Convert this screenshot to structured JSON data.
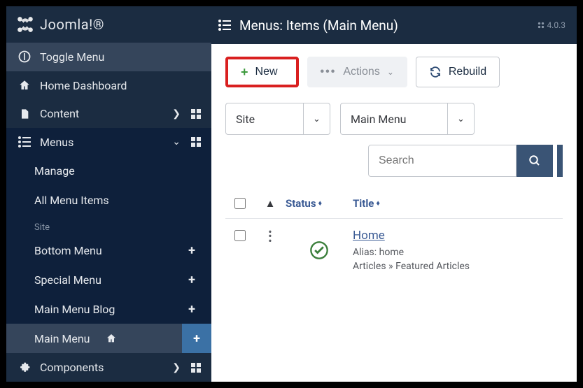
{
  "brand": {
    "name": "Joomla!®"
  },
  "version": "4.0.3",
  "sidebar": {
    "toggle": "Toggle Menu",
    "items": [
      {
        "label": "Home Dashboard",
        "icon": "home"
      },
      {
        "label": "Content",
        "icon": "file",
        "chevron": "right",
        "grid": true
      },
      {
        "label": "Menus",
        "icon": "list",
        "chevron": "down",
        "grid": true,
        "expanded": true
      },
      {
        "label": "Components",
        "icon": "puzzle",
        "chevron": "right",
        "grid": true
      }
    ],
    "submenu": {
      "items": [
        {
          "label": "Manage",
          "type": "link"
        },
        {
          "label": "All Menu Items",
          "type": "link"
        },
        {
          "label": "Site",
          "type": "heading"
        },
        {
          "label": "Bottom Menu",
          "type": "menu"
        },
        {
          "label": "Special Menu",
          "type": "menu"
        },
        {
          "label": "Main Menu Blog",
          "type": "menu"
        },
        {
          "label": "Main Menu",
          "type": "menu",
          "home": true,
          "active": true
        }
      ]
    }
  },
  "page": {
    "title": "Menus: Items (Main Menu)"
  },
  "toolbar": {
    "new_label": "New",
    "actions_label": "Actions",
    "rebuild_label": "Rebuild"
  },
  "filters": {
    "client": "Site",
    "menu": "Main Menu",
    "search_placeholder": "Search"
  },
  "table": {
    "headers": {
      "status": "Status",
      "title": "Title"
    },
    "rows": [
      {
        "title": "Home",
        "alias_label": "Alias:",
        "alias": "home",
        "path": "Articles » Featured Articles",
        "status": "published"
      }
    ]
  }
}
